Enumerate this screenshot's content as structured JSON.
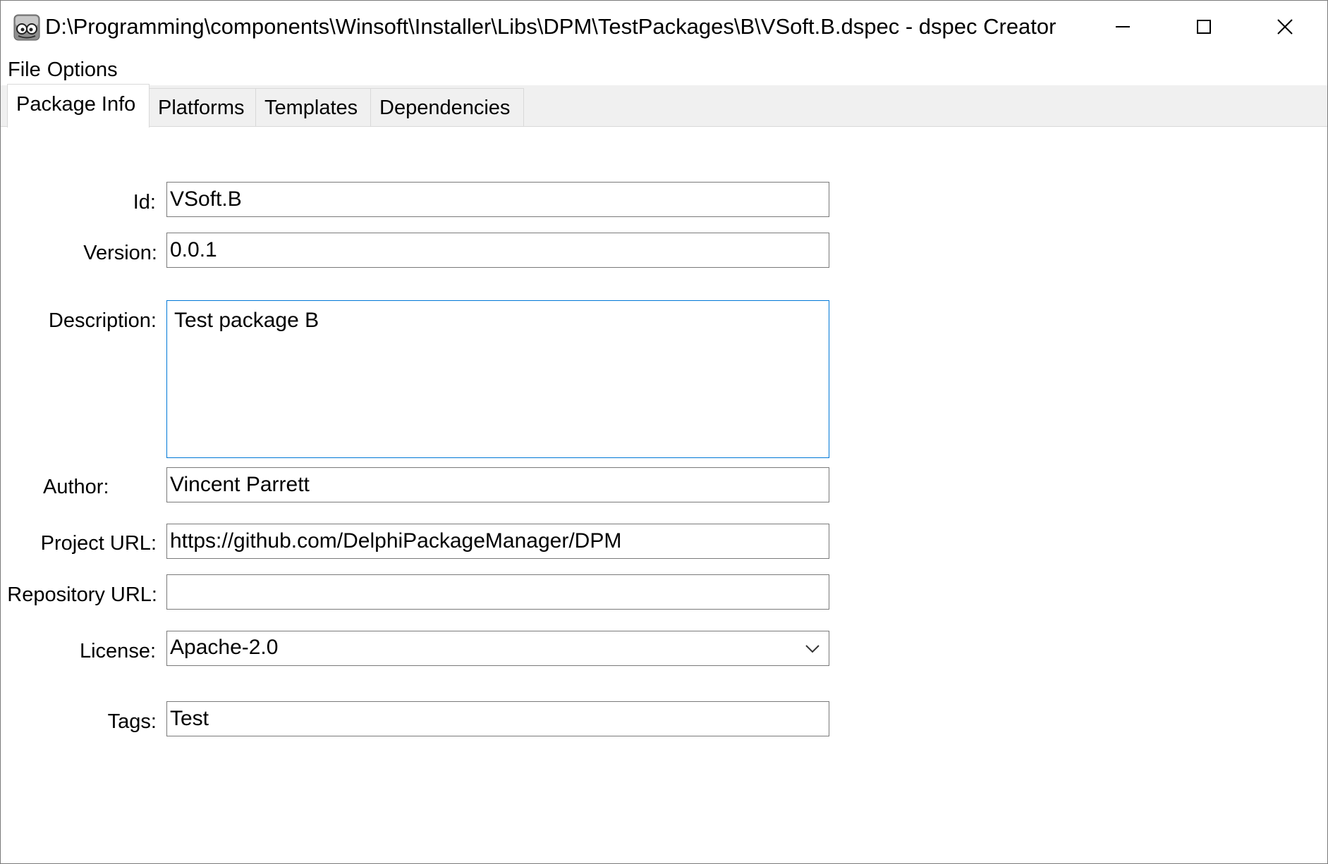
{
  "window": {
    "title": "D:\\Programming\\components\\Winsoft\\Installer\\Libs\\DPM\\TestPackages\\B\\VSoft.B.dspec - dspec Creator",
    "icon": "app-glasses-icon",
    "controls": [
      "minimize-icon",
      "maximize-icon",
      "close-icon"
    ]
  },
  "menu": {
    "items": [
      {
        "label": "File"
      },
      {
        "label": "Options"
      }
    ]
  },
  "tabs": [
    {
      "label": "Package Info",
      "active": true
    },
    {
      "label": "Platforms",
      "active": false
    },
    {
      "label": "Templates",
      "active": false
    },
    {
      "label": "Dependencies",
      "active": false
    }
  ],
  "form": {
    "id": {
      "label": "Id:",
      "value": "VSoft.B"
    },
    "version": {
      "label": "Version:",
      "value": "0.0.1"
    },
    "description": {
      "label": "Description:",
      "value": "Test package B"
    },
    "author": {
      "label": "Author:",
      "value": "Vincent Parrett"
    },
    "project_url": {
      "label": "Project URL:",
      "value": "https://github.com/DelphiPackageManager/DPM"
    },
    "repository_url": {
      "label": "Repository URL:",
      "value": ""
    },
    "license": {
      "label": "License:",
      "value": "Apache-2.0"
    },
    "tags": {
      "label": "Tags:",
      "value": "Test"
    }
  },
  "colors": {
    "focus_border": "#0078d7",
    "field_border": "#7a7a7a",
    "tab_strip": "#f0f0f0"
  }
}
